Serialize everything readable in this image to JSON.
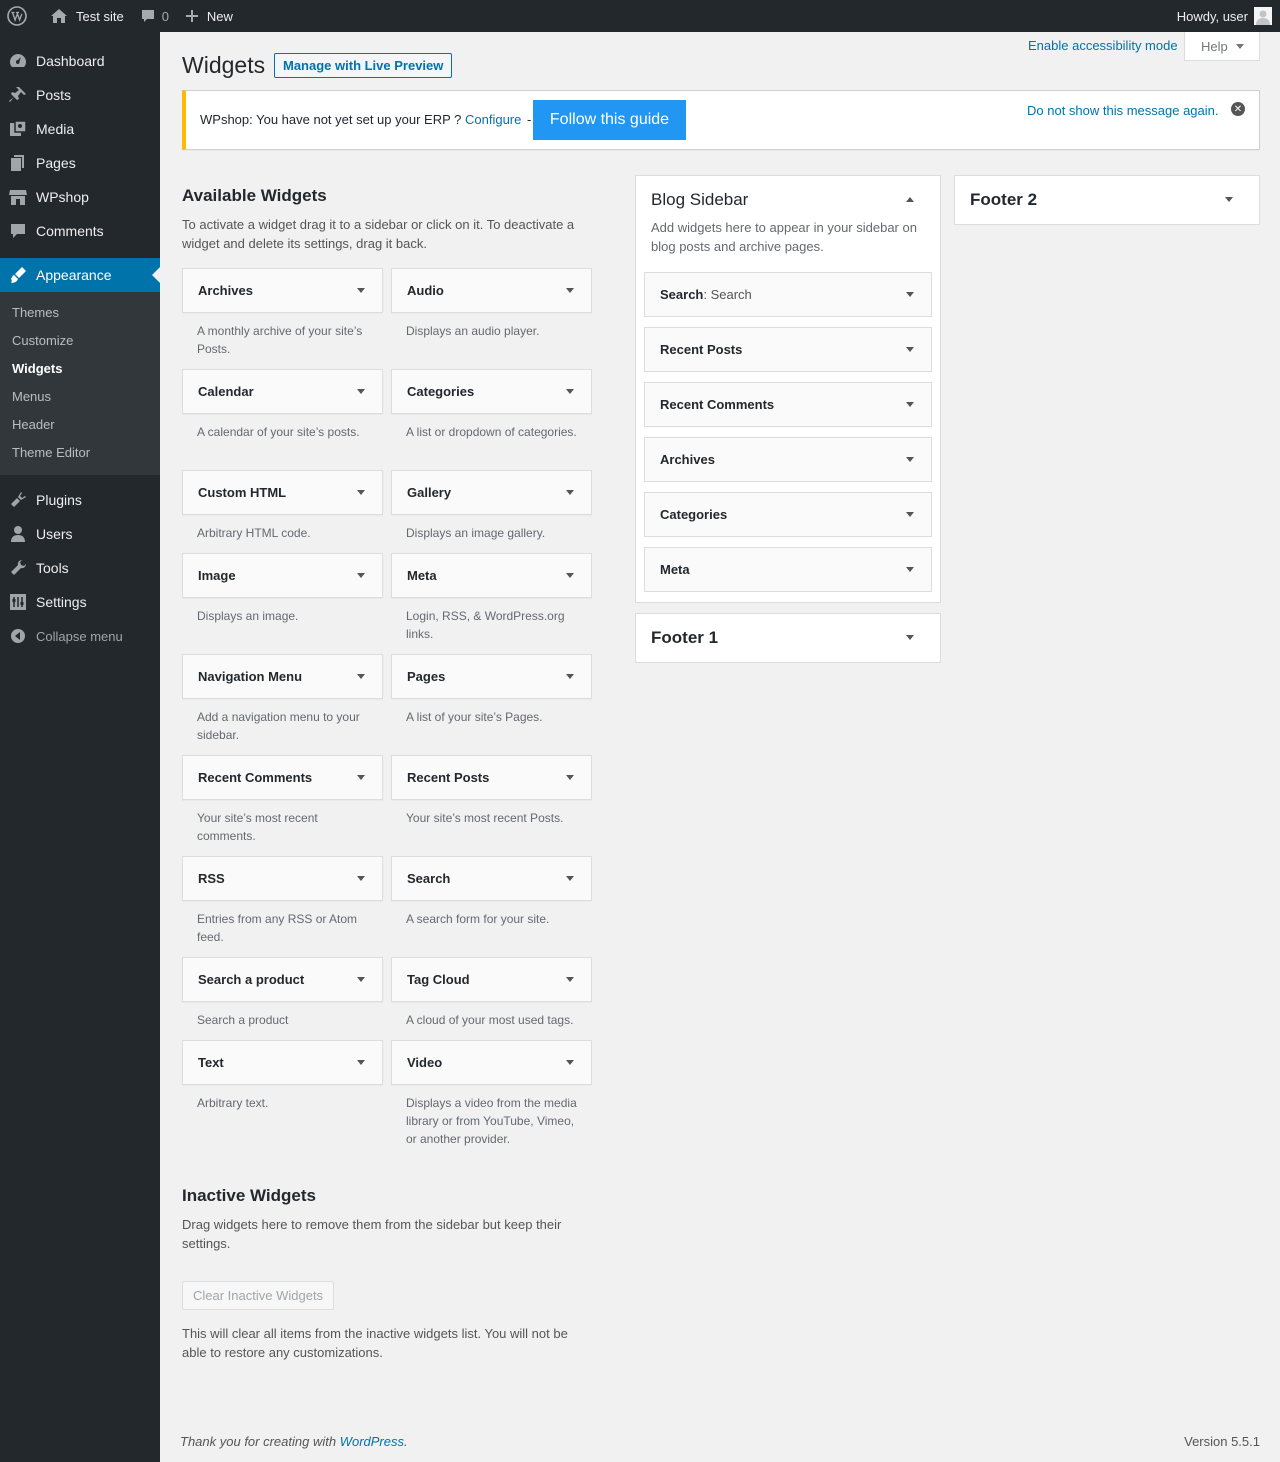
{
  "adminbar": {
    "site_name": "Test site",
    "comments_count": "0",
    "new_label": "New",
    "howdy": "Howdy, user"
  },
  "sidebar": {
    "items_top": [
      {
        "label": "Dashboard",
        "icon": "dashboard-icon"
      },
      {
        "label": "Posts",
        "icon": "pin-icon"
      },
      {
        "label": "Media",
        "icon": "media-icon"
      },
      {
        "label": "Pages",
        "icon": "pages-icon"
      },
      {
        "label": "WPshop",
        "icon": "store-icon"
      },
      {
        "label": "Comments",
        "icon": "comment-icon"
      }
    ],
    "current": {
      "label": "Appearance",
      "icon": "brush-icon"
    },
    "submenu": [
      "Themes",
      "Customize",
      "Widgets",
      "Menus",
      "Header",
      "Theme Editor"
    ],
    "items_bottom": [
      {
        "label": "Plugins",
        "icon": "plugin-icon"
      },
      {
        "label": "Users",
        "icon": "user-icon"
      },
      {
        "label": "Tools",
        "icon": "wrench-icon"
      },
      {
        "label": "Settings",
        "icon": "settings-icon"
      }
    ],
    "collapse_label": "Collapse menu"
  },
  "header": {
    "accessibility_link": "Enable accessibility mode",
    "help_label": "Help",
    "title": "Widgets",
    "live_preview_label": "Manage with Live Preview"
  },
  "notice": {
    "text": "WPshop: You have not yet set up your ERP ?",
    "configure_label": "Configure",
    "separator": "-",
    "follow_label": "Follow this guide",
    "dismiss_label": "Do not show this message again."
  },
  "available": {
    "title": "Available Widgets",
    "description": "To activate a widget drag it to a sidebar or click on it. To deactivate a widget and delete its settings, drag it back.",
    "widgets": [
      {
        "title": "Archives",
        "desc": "A monthly archive of your site’s Posts."
      },
      {
        "title": "Audio",
        "desc": "Displays an audio player."
      },
      {
        "title": "Calendar",
        "desc": "A calendar of your site’s posts."
      },
      {
        "title": "Categories",
        "desc": "A list or dropdown of categories."
      },
      {
        "title": "Custom HTML",
        "desc": "Arbitrary HTML code."
      },
      {
        "title": "Gallery",
        "desc": "Displays an image gallery."
      },
      {
        "title": "Image",
        "desc": "Displays an image."
      },
      {
        "title": "Meta",
        "desc": "Login, RSS, & WordPress.org links."
      },
      {
        "title": "Navigation Menu",
        "desc": "Add a navigation menu to your sidebar."
      },
      {
        "title": "Pages",
        "desc": "A list of your site’s Pages."
      },
      {
        "title": "Recent Comments",
        "desc": "Your site’s most recent comments."
      },
      {
        "title": "Recent Posts",
        "desc": "Your site’s most recent Posts."
      },
      {
        "title": "RSS",
        "desc": "Entries from any RSS or Atom feed."
      },
      {
        "title": "Search",
        "desc": "A search form for your site."
      },
      {
        "title": "Search a product",
        "desc": "Search a product"
      },
      {
        "title": "Tag Cloud",
        "desc": "A cloud of your most used tags."
      },
      {
        "title": "Text",
        "desc": "Arbitrary text."
      },
      {
        "title": "Video",
        "desc": "Displays a video from the media library or from YouTube, Vimeo, or another provider."
      }
    ]
  },
  "blog_sidebar": {
    "title": "Blog Sidebar",
    "description": "Add widgets here to appear in your sidebar on blog posts and archive pages.",
    "widgets": [
      {
        "title": "Search",
        "subtitle": ": Search"
      },
      {
        "title": "Recent Posts",
        "subtitle": ""
      },
      {
        "title": "Recent Comments",
        "subtitle": ""
      },
      {
        "title": "Archives",
        "subtitle": ""
      },
      {
        "title": "Categories",
        "subtitle": ""
      },
      {
        "title": "Meta",
        "subtitle": ""
      }
    ]
  },
  "footer1": {
    "title": "Footer 1"
  },
  "footer2": {
    "title": "Footer 2"
  },
  "inactive": {
    "title": "Inactive Widgets",
    "description": "Drag widgets here to remove them from the sidebar but keep their settings.",
    "clear_label": "Clear Inactive Widgets",
    "note": "This will clear all items from the inactive widgets list. You will not be able to restore any customizations."
  },
  "footer": {
    "thanks_prefix": "Thank you for creating with",
    "wp_link": "WordPress",
    "thanks_suffix": ".",
    "version": "Version 5.5.1"
  },
  "colors": {
    "adminbar_bg": "#23282d",
    "accent": "#0073aa",
    "notice_border": "#ffb900",
    "follow_btn": "#2196F3"
  }
}
